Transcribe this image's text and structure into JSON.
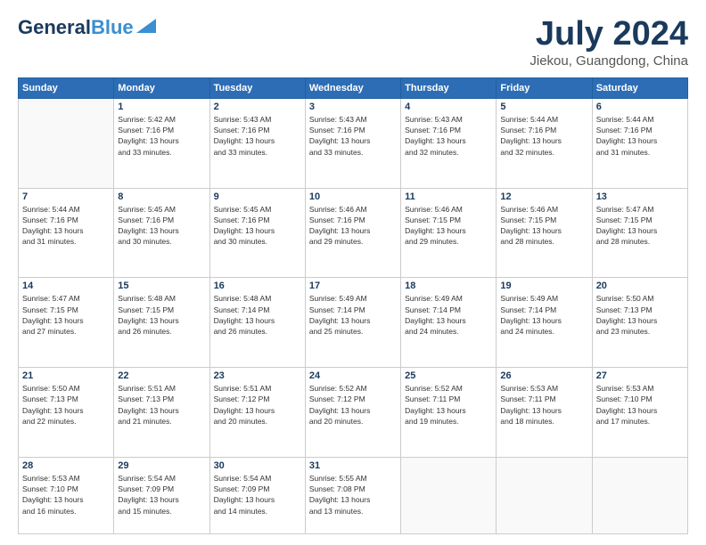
{
  "header": {
    "logo_line1a": "General",
    "logo_line1b": "Blue",
    "title": "July 2024",
    "location": "Jiekou, Guangdong, China"
  },
  "days_of_week": [
    "Sunday",
    "Monday",
    "Tuesday",
    "Wednesday",
    "Thursday",
    "Friday",
    "Saturday"
  ],
  "weeks": [
    [
      {
        "day": "",
        "info": ""
      },
      {
        "day": "1",
        "info": "Sunrise: 5:42 AM\nSunset: 7:16 PM\nDaylight: 13 hours\nand 33 minutes."
      },
      {
        "day": "2",
        "info": "Sunrise: 5:43 AM\nSunset: 7:16 PM\nDaylight: 13 hours\nand 33 minutes."
      },
      {
        "day": "3",
        "info": "Sunrise: 5:43 AM\nSunset: 7:16 PM\nDaylight: 13 hours\nand 33 minutes."
      },
      {
        "day": "4",
        "info": "Sunrise: 5:43 AM\nSunset: 7:16 PM\nDaylight: 13 hours\nand 32 minutes."
      },
      {
        "day": "5",
        "info": "Sunrise: 5:44 AM\nSunset: 7:16 PM\nDaylight: 13 hours\nand 32 minutes."
      },
      {
        "day": "6",
        "info": "Sunrise: 5:44 AM\nSunset: 7:16 PM\nDaylight: 13 hours\nand 31 minutes."
      }
    ],
    [
      {
        "day": "7",
        "info": "Sunrise: 5:44 AM\nSunset: 7:16 PM\nDaylight: 13 hours\nand 31 minutes."
      },
      {
        "day": "8",
        "info": "Sunrise: 5:45 AM\nSunset: 7:16 PM\nDaylight: 13 hours\nand 30 minutes."
      },
      {
        "day": "9",
        "info": "Sunrise: 5:45 AM\nSunset: 7:16 PM\nDaylight: 13 hours\nand 30 minutes."
      },
      {
        "day": "10",
        "info": "Sunrise: 5:46 AM\nSunset: 7:16 PM\nDaylight: 13 hours\nand 29 minutes."
      },
      {
        "day": "11",
        "info": "Sunrise: 5:46 AM\nSunset: 7:15 PM\nDaylight: 13 hours\nand 29 minutes."
      },
      {
        "day": "12",
        "info": "Sunrise: 5:46 AM\nSunset: 7:15 PM\nDaylight: 13 hours\nand 28 minutes."
      },
      {
        "day": "13",
        "info": "Sunrise: 5:47 AM\nSunset: 7:15 PM\nDaylight: 13 hours\nand 28 minutes."
      }
    ],
    [
      {
        "day": "14",
        "info": "Sunrise: 5:47 AM\nSunset: 7:15 PM\nDaylight: 13 hours\nand 27 minutes."
      },
      {
        "day": "15",
        "info": "Sunrise: 5:48 AM\nSunset: 7:15 PM\nDaylight: 13 hours\nand 26 minutes."
      },
      {
        "day": "16",
        "info": "Sunrise: 5:48 AM\nSunset: 7:14 PM\nDaylight: 13 hours\nand 26 minutes."
      },
      {
        "day": "17",
        "info": "Sunrise: 5:49 AM\nSunset: 7:14 PM\nDaylight: 13 hours\nand 25 minutes."
      },
      {
        "day": "18",
        "info": "Sunrise: 5:49 AM\nSunset: 7:14 PM\nDaylight: 13 hours\nand 24 minutes."
      },
      {
        "day": "19",
        "info": "Sunrise: 5:49 AM\nSunset: 7:14 PM\nDaylight: 13 hours\nand 24 minutes."
      },
      {
        "day": "20",
        "info": "Sunrise: 5:50 AM\nSunset: 7:13 PM\nDaylight: 13 hours\nand 23 minutes."
      }
    ],
    [
      {
        "day": "21",
        "info": "Sunrise: 5:50 AM\nSunset: 7:13 PM\nDaylight: 13 hours\nand 22 minutes."
      },
      {
        "day": "22",
        "info": "Sunrise: 5:51 AM\nSunset: 7:13 PM\nDaylight: 13 hours\nand 21 minutes."
      },
      {
        "day": "23",
        "info": "Sunrise: 5:51 AM\nSunset: 7:12 PM\nDaylight: 13 hours\nand 20 minutes."
      },
      {
        "day": "24",
        "info": "Sunrise: 5:52 AM\nSunset: 7:12 PM\nDaylight: 13 hours\nand 20 minutes."
      },
      {
        "day": "25",
        "info": "Sunrise: 5:52 AM\nSunset: 7:11 PM\nDaylight: 13 hours\nand 19 minutes."
      },
      {
        "day": "26",
        "info": "Sunrise: 5:53 AM\nSunset: 7:11 PM\nDaylight: 13 hours\nand 18 minutes."
      },
      {
        "day": "27",
        "info": "Sunrise: 5:53 AM\nSunset: 7:10 PM\nDaylight: 13 hours\nand 17 minutes."
      }
    ],
    [
      {
        "day": "28",
        "info": "Sunrise: 5:53 AM\nSunset: 7:10 PM\nDaylight: 13 hours\nand 16 minutes."
      },
      {
        "day": "29",
        "info": "Sunrise: 5:54 AM\nSunset: 7:09 PM\nDaylight: 13 hours\nand 15 minutes."
      },
      {
        "day": "30",
        "info": "Sunrise: 5:54 AM\nSunset: 7:09 PM\nDaylight: 13 hours\nand 14 minutes."
      },
      {
        "day": "31",
        "info": "Sunrise: 5:55 AM\nSunset: 7:08 PM\nDaylight: 13 hours\nand 13 minutes."
      },
      {
        "day": "",
        "info": ""
      },
      {
        "day": "",
        "info": ""
      },
      {
        "day": "",
        "info": ""
      }
    ]
  ]
}
